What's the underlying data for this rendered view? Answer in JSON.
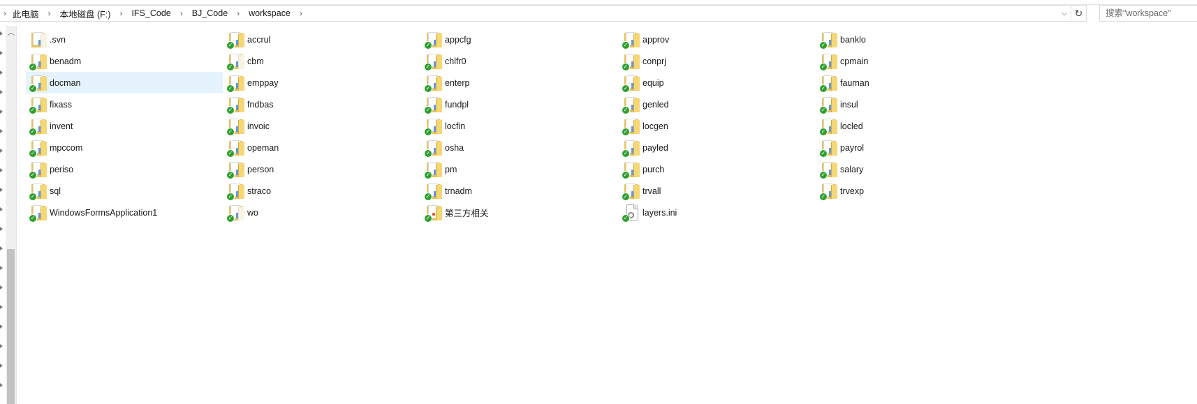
{
  "address_bar": {
    "breadcrumbs": [
      "此电脑",
      "本地磁盘 (F:)",
      "IFS_Code",
      "BJ_Code",
      "workspace"
    ]
  },
  "search": {
    "placeholder": "搜索\"workspace\""
  },
  "icons": {
    "folder": "folder-icon",
    "file": "settings-file-icon",
    "badge": "svn-normal-checkmark-icon"
  },
  "colors": {
    "selection": "#e5f3ff",
    "folder": "#e8c25a",
    "badge": "#2fa02f"
  },
  "files": {
    "items": [
      {
        "name": ".svn",
        "type": "folder",
        "style": "pale",
        "badge": false
      },
      {
        "name": "accrul",
        "type": "folder",
        "badge": true
      },
      {
        "name": "appcfg",
        "type": "folder",
        "badge": true
      },
      {
        "name": "approv",
        "type": "folder",
        "badge": true
      },
      {
        "name": "banklo",
        "type": "folder",
        "badge": true
      },
      {
        "name": "benadm",
        "type": "folder",
        "badge": true
      },
      {
        "name": "cbm",
        "type": "folder",
        "style": "pale",
        "badge": true
      },
      {
        "name": "chlfr0",
        "type": "folder",
        "badge": true
      },
      {
        "name": "conprj",
        "type": "folder",
        "badge": true
      },
      {
        "name": "cpmain",
        "type": "folder",
        "badge": true
      },
      {
        "name": "docman",
        "type": "folder",
        "badge": true,
        "selected": true
      },
      {
        "name": "emppay",
        "type": "folder",
        "badge": true
      },
      {
        "name": "enterp",
        "type": "folder",
        "badge": true
      },
      {
        "name": "equip",
        "type": "folder",
        "badge": true
      },
      {
        "name": "fauman",
        "type": "folder",
        "badge": true
      },
      {
        "name": "fixass",
        "type": "folder",
        "badge": true
      },
      {
        "name": "fndbas",
        "type": "folder",
        "badge": true
      },
      {
        "name": "fundpl",
        "type": "folder",
        "badge": true
      },
      {
        "name": "genled",
        "type": "folder",
        "badge": true
      },
      {
        "name": "insul",
        "type": "folder",
        "badge": true
      },
      {
        "name": "invent",
        "type": "folder",
        "badge": true
      },
      {
        "name": "invoic",
        "type": "folder",
        "badge": true
      },
      {
        "name": "locfin",
        "type": "folder",
        "badge": true
      },
      {
        "name": "locgen",
        "type": "folder",
        "badge": true
      },
      {
        "name": "locled",
        "type": "folder",
        "badge": true
      },
      {
        "name": "mpccom",
        "type": "folder",
        "badge": true
      },
      {
        "name": "opeman",
        "type": "folder",
        "badge": true
      },
      {
        "name": "osha",
        "type": "folder",
        "badge": true
      },
      {
        "name": "payled",
        "type": "folder",
        "badge": true
      },
      {
        "name": "payrol",
        "type": "folder",
        "badge": true
      },
      {
        "name": "periso",
        "type": "folder",
        "badge": true
      },
      {
        "name": "person",
        "type": "folder",
        "badge": true
      },
      {
        "name": "pm",
        "type": "folder",
        "badge": true
      },
      {
        "name": "purch",
        "type": "folder",
        "badge": true
      },
      {
        "name": "salary",
        "type": "folder",
        "badge": true
      },
      {
        "name": "sql",
        "type": "folder",
        "badge": true
      },
      {
        "name": "straco",
        "type": "folder",
        "badge": true
      },
      {
        "name": "trnadm",
        "type": "folder",
        "badge": true
      },
      {
        "name": "trvall",
        "type": "folder",
        "badge": true
      },
      {
        "name": "trvexp",
        "type": "folder",
        "badge": true
      },
      {
        "name": "WindowsFormsApplication1",
        "type": "folder",
        "badge": true
      },
      {
        "name": "wo",
        "type": "folder",
        "style": "pale",
        "badge": true
      },
      {
        "name": "第三方相关",
        "type": "folder",
        "mark": "red",
        "badge": true
      },
      {
        "name": "layers.ini",
        "type": "file",
        "badge": true
      }
    ]
  }
}
